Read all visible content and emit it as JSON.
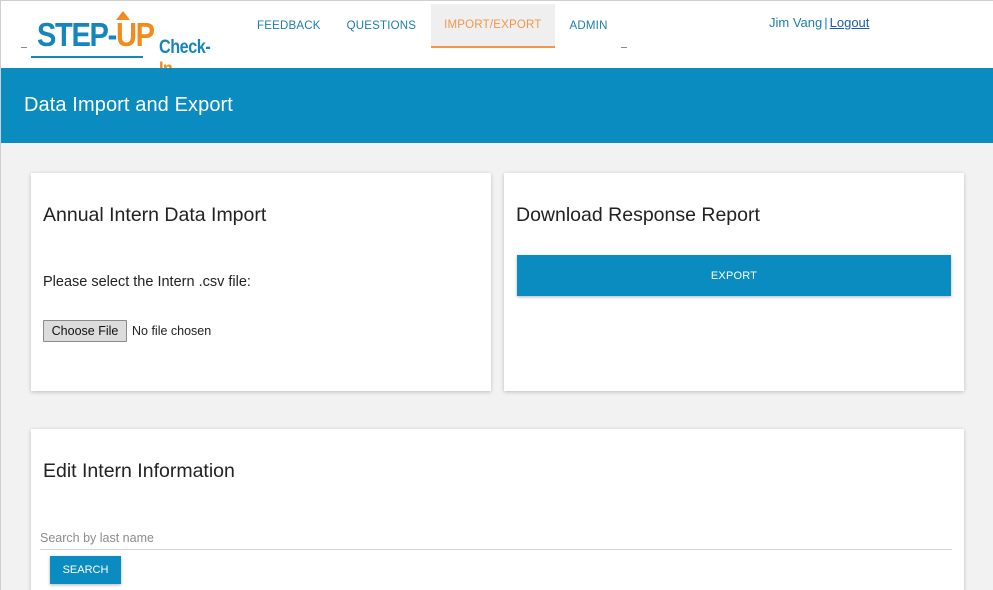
{
  "brand": {
    "logo_main": "STEP",
    "logo_accent": "UP",
    "subtitle_main": "Check-",
    "subtitle_accent": "In",
    "primary_color": "#0b8cc1",
    "accent_color": "#f28a1d"
  },
  "nav": {
    "tabs": [
      {
        "label": "FEEDBACK",
        "active": false
      },
      {
        "label": "QUESTIONS",
        "active": false
      },
      {
        "label": "IMPORT/EXPORT",
        "active": true
      },
      {
        "label": "ADMIN",
        "active": false
      }
    ]
  },
  "user": {
    "name": "Jim Vang",
    "separator": "|",
    "logout_label": "Logout"
  },
  "header": {
    "title": "Data Import and Export"
  },
  "import_card": {
    "title": "Annual Intern Data Import",
    "prompt": "Please select the Intern .csv file:",
    "choose_label": "Choose File",
    "file_status": "No file chosen"
  },
  "download_card": {
    "title": "Download Response Report",
    "export_label": "EXPORT"
  },
  "edit_card": {
    "title": "Edit Intern Information",
    "search_placeholder": "Search by last name",
    "search_value": "",
    "search_label": "SEARCH"
  }
}
